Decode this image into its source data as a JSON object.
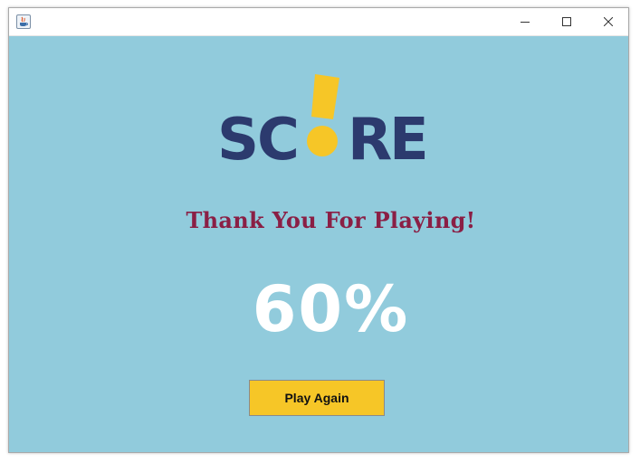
{
  "window": {
    "title": "",
    "background": "#91cbdc",
    "controls": {
      "minimize": "minimize-icon",
      "maximize": "maximize-icon",
      "close": "close-icon"
    }
  },
  "logo": {
    "text": "SCORE",
    "colors": {
      "letters": "#2c3a6e",
      "accent": "#f6c627"
    }
  },
  "message": {
    "text": "Thank You For Playing!",
    "color": "#8a1f45"
  },
  "score": {
    "value": "60%"
  },
  "play_again": {
    "label": "Play Again",
    "color": "#f6c627"
  }
}
